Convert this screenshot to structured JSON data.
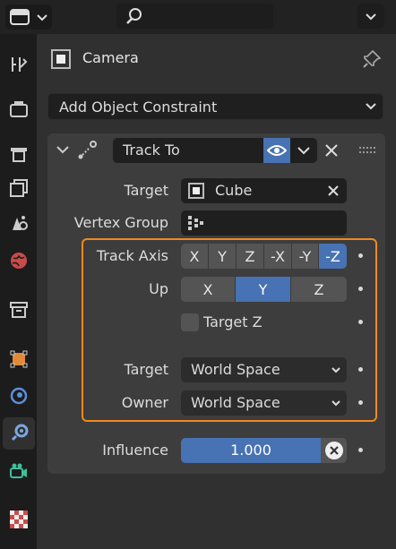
{
  "header": {
    "object_name": "Camera"
  },
  "add_constraint": {
    "label": "Add Object Constraint"
  },
  "constraint": {
    "name": "Track To",
    "target": {
      "label": "Target",
      "value": "Cube"
    },
    "vertex_group": {
      "label": "Vertex Group",
      "value": ""
    },
    "track_axis": {
      "label": "Track Axis",
      "options": [
        "X",
        "Y",
        "Z",
        "-X",
        "-Y",
        "-Z"
      ],
      "selected": "-Z"
    },
    "up": {
      "label": "Up",
      "options": [
        "X",
        "Y",
        "Z"
      ],
      "selected": "Y"
    },
    "target_z": {
      "label": "Target Z",
      "checked": false
    },
    "target_space": {
      "label": "Target",
      "value": "World Space"
    },
    "owner_space": {
      "label": "Owner",
      "value": "World Space"
    },
    "influence": {
      "label": "Influence",
      "value": "1.000",
      "fraction": 1.0
    }
  },
  "colors": {
    "accent": "#4772b3",
    "highlight": "#ef8a1c",
    "panel": "#3d3d3d",
    "background": "#303030"
  },
  "icons": [
    "editor-type-icon",
    "search-icon",
    "chevron-down-icon",
    "tool-icon",
    "render-icon",
    "output-icon",
    "view-layer-icon",
    "scene-icon",
    "world-icon",
    "collection-icon",
    "object-icon",
    "physics-icon",
    "constraint-icon",
    "data-icon",
    "texture-icon",
    "camera-icon",
    "pin-icon",
    "eye-icon",
    "close-icon",
    "drag-handle-icon",
    "vertex-group-icon",
    "cube-icon"
  ]
}
